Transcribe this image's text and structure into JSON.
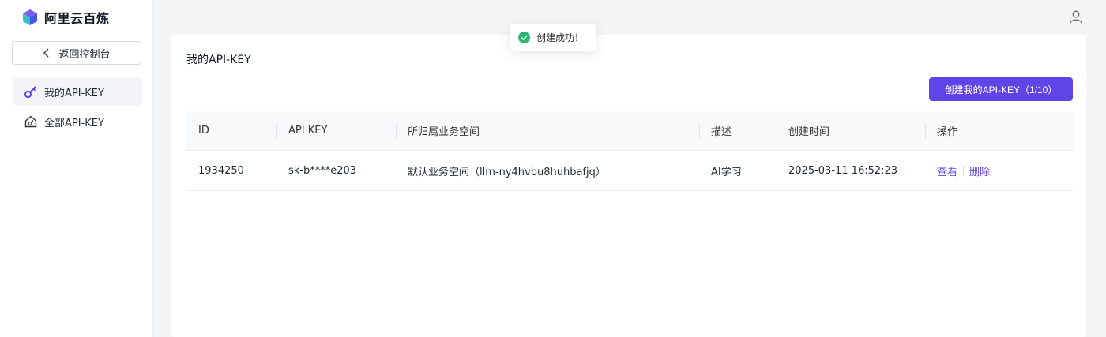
{
  "brand": {
    "name": "阿里云百炼"
  },
  "sidebar": {
    "back_label": "返回控制台",
    "items": [
      {
        "label": "我的API-KEY",
        "icon": "key-icon",
        "active": true
      },
      {
        "label": "全部API-KEY",
        "icon": "house-key-icon",
        "active": false
      }
    ]
  },
  "toast": {
    "message": "创建成功！",
    "icon": "check-circle-icon",
    "color": "#2bb673"
  },
  "main": {
    "title": "我的API-KEY",
    "create_button_label": "创建我的API-KEY（1/10）",
    "accent_color": "#6144e8",
    "table": {
      "headers": [
        "ID",
        "API KEY",
        "所归属业务空间",
        "描述",
        "创建时间",
        "操作"
      ],
      "rows": [
        {
          "id": "1934250",
          "api_key": "sk-b****e203",
          "workspace": "默认业务空间（llm-ny4hvbu8huhbafjq）",
          "description": "AI学习",
          "created_at": "2025-03-11 16:52:23",
          "actions": [
            "查看",
            "删除"
          ]
        }
      ]
    }
  }
}
